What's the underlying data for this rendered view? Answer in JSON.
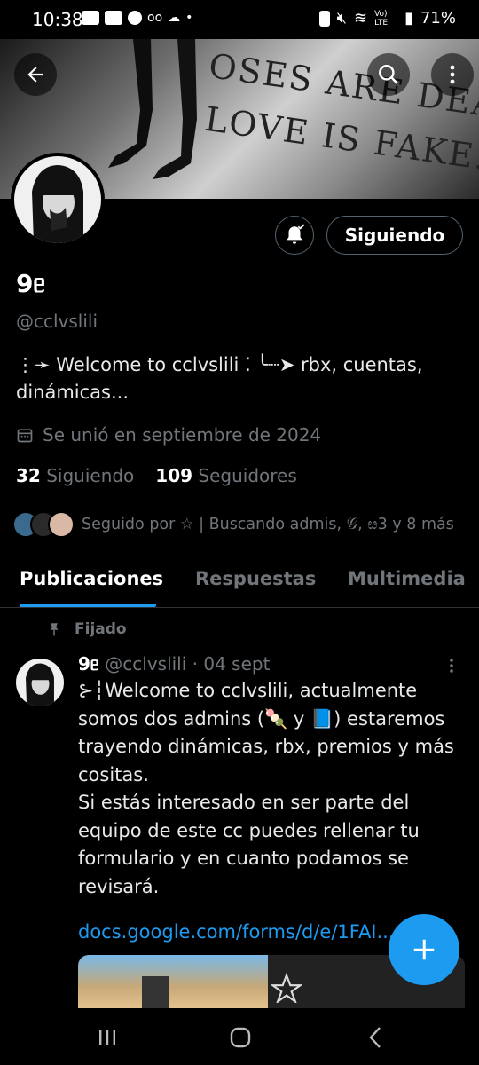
{
  "status_bar": {
    "time": "10:38",
    "volte_label": "Vo) LTE",
    "battery": "71%"
  },
  "banner": {
    "carved_line1": "OSES ARE DEAD,",
    "carved_line2": "LOVE IS FAKE."
  },
  "profile": {
    "name": "9ᥱ",
    "handle": "@cclvslili",
    "bio": "⋮➛ Welcome to cclvslili ⁚ ╰┈➤ rbx, cuentas, dinámicas...",
    "joined": "Se unió en septiembre de 2024",
    "following_count": "32",
    "following_label": "Siguiendo",
    "followers_count": "109",
    "followers_label": "Seguidores",
    "followed_by": "Seguido por ☆ | Buscando admis, 𝒢, ೞ3 y 8 más",
    "follow_button": "Siguiendo"
  },
  "tabs": [
    {
      "label": "Publicaciones",
      "active": true
    },
    {
      "label": "Respuestas",
      "active": false
    },
    {
      "label": "Multimedia",
      "active": false
    }
  ],
  "pinned_post": {
    "pinned_label": "Fijado",
    "author_name": "9ᥱ",
    "author_handle": "@cclvslili",
    "date": "· 04 sept",
    "text": "⊱┆Welcome to cclvslili, actualmente somos dos admins (🍡 y 📘) estaremos trayendo dinámicas, rbx, premios y más cositas.\nSi estás interesado en ser parte del equipo de este cc puedes rellenar tu formulario y en cuanto podamos se revisará.",
    "link": "docs.google.com/forms/d/e/1FAI..."
  },
  "colors": {
    "accent": "#1d9bf0",
    "muted": "#71767b",
    "background": "#000000",
    "divider": "#2f3336"
  },
  "icons": {
    "back": "back-arrow-icon",
    "search": "search-icon",
    "more": "more-vertical-icon",
    "bell": "bell-check-icon",
    "calendar": "calendar-icon",
    "pin": "pin-icon",
    "compose": "plus-icon"
  }
}
